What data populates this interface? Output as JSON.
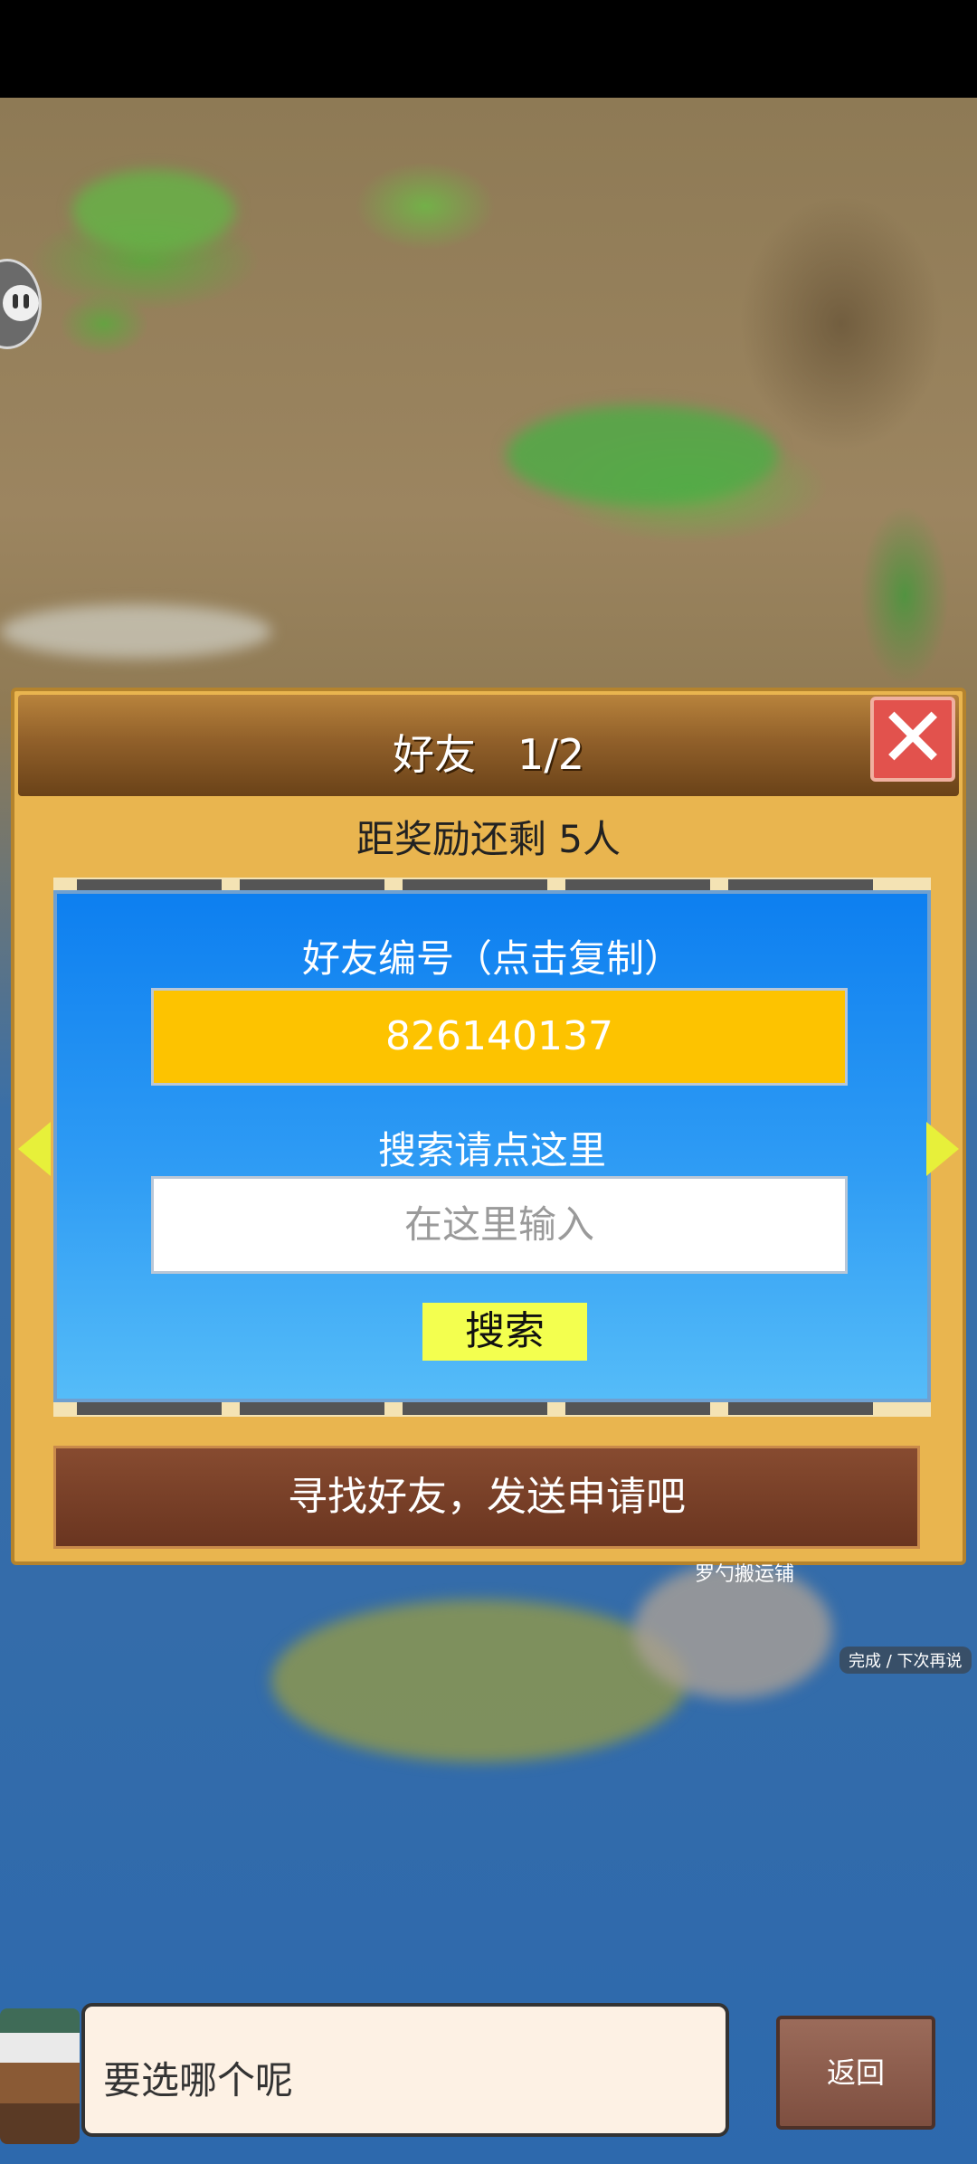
{
  "dialog": {
    "title": "好友　1/2",
    "close_symbol": "✕",
    "reward_text": "距奖励还剩 5人",
    "friend_id_label": "好友编号（点击复制）",
    "friend_id": "826140137",
    "search_label": "搜索请点这里",
    "search_placeholder": "在这里输入",
    "search_button": "搜索",
    "find_friends": "寻找好友，发送申请吧"
  },
  "map": {
    "hint": "完成 / 下次再说",
    "shop_label": "罗勺搬运铺"
  },
  "bottom": {
    "speech": "要选哪个呢",
    "back_button": "返回"
  },
  "colors": {
    "panel": "#e9b54f",
    "friend_id_box": "#fdc300",
    "search_button": "#f3ff4f",
    "close_button": "#e2524d"
  }
}
